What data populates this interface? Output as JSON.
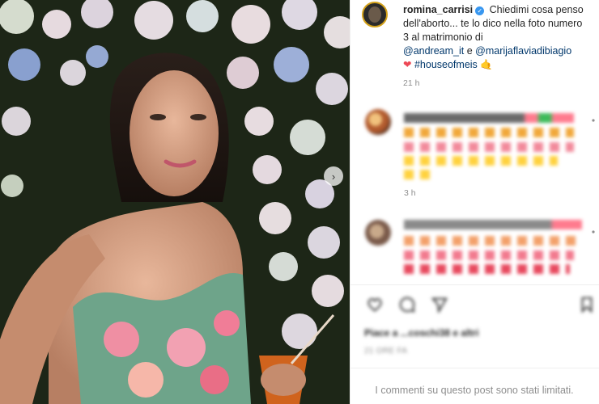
{
  "post": {
    "username": "romina_carrisi",
    "caption_part1": "Chiedimi cosa penso dell'aborto... te lo dico nella foto numero 3 al matrimonio di",
    "mention1": "@andream_it",
    "caption_and": "e",
    "mention2": "@marijaflaviadibiagio",
    "heart": "❤",
    "hashtag": "#houseofmeis",
    "wave": "🤙",
    "time": "21 h"
  },
  "comments": [
    {
      "username": "pa_tta_____",
      "text": "(blurred comment text)",
      "time": "3 h"
    },
    {
      "username": "cosepazzeo",
      "text": "Sei bellissima Romina",
      "time": ""
    }
  ],
  "likes": {
    "text": "Piace a ...coschi38 e altri"
  },
  "date": "21 ORE FA",
  "comments_limited": "I commenti su questo post sono stati limitati.",
  "colors": {
    "link": "#00376b",
    "secondary": "#8e8e8e",
    "verified": "#3897f0",
    "heart": "#ed4956"
  }
}
